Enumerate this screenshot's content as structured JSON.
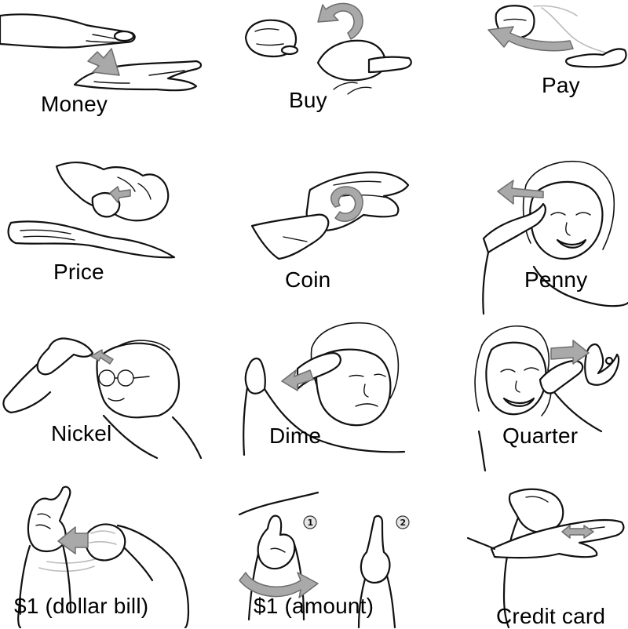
{
  "signs": [
    {
      "label": "Money"
    },
    {
      "label": "Buy"
    },
    {
      "label": "Pay"
    },
    {
      "label": "Price"
    },
    {
      "label": "Coin"
    },
    {
      "label": "Penny"
    },
    {
      "label": "Nickel"
    },
    {
      "label": "Dime"
    },
    {
      "label": "Quarter"
    },
    {
      "label": "$1 (dollar bill)"
    },
    {
      "label": "$1 (amount)",
      "step_markers": [
        "1",
        "2"
      ]
    },
    {
      "label": "Credit card"
    }
  ],
  "colors": {
    "arrow_fill": "#a9a9a9",
    "line": "#111111",
    "background": "#ffffff"
  }
}
